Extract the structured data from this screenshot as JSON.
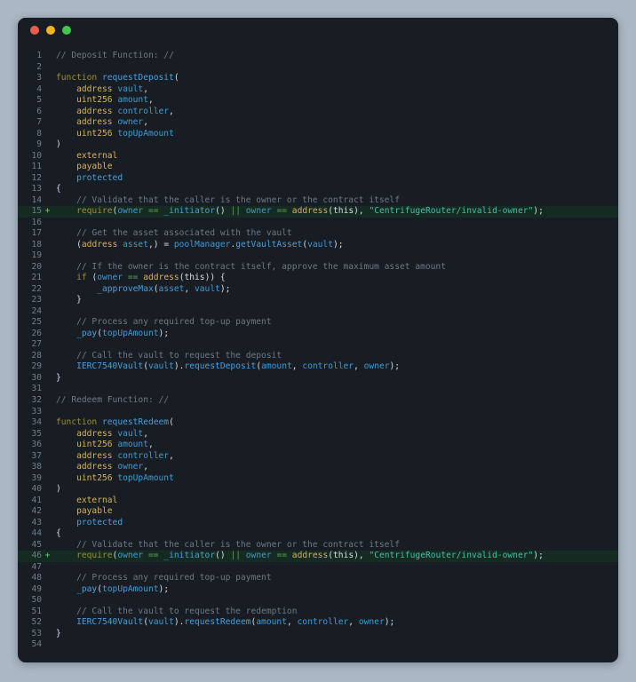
{
  "window": {
    "title": "",
    "traffic_lights": [
      {
        "name": "close-button",
        "color": "#f05c52"
      },
      {
        "name": "minimize-button",
        "color": "#f2b518"
      },
      {
        "name": "maximize-button",
        "color": "#41c64e"
      }
    ]
  },
  "editor": {
    "language": "solidity",
    "theme_background": "#181d24",
    "added_line_background": "#152a21",
    "lines": [
      {
        "n": "1",
        "marker": "",
        "added": false,
        "text": "// Deposit Function: //"
      },
      {
        "n": "2",
        "marker": "",
        "added": false,
        "text": ""
      },
      {
        "n": "3",
        "marker": "",
        "added": false,
        "text": "function requestDeposit("
      },
      {
        "n": "4",
        "marker": "",
        "added": false,
        "text": "    address vault,"
      },
      {
        "n": "5",
        "marker": "",
        "added": false,
        "text": "    uint256 amount,"
      },
      {
        "n": "6",
        "marker": "",
        "added": false,
        "text": "    address controller,"
      },
      {
        "n": "7",
        "marker": "",
        "added": false,
        "text": "    address owner,"
      },
      {
        "n": "8",
        "marker": "",
        "added": false,
        "text": "    uint256 topUpAmount"
      },
      {
        "n": "9",
        "marker": "",
        "added": false,
        "text": ")"
      },
      {
        "n": "10",
        "marker": "",
        "added": false,
        "text": "    external"
      },
      {
        "n": "11",
        "marker": "",
        "added": false,
        "text": "    payable"
      },
      {
        "n": "12",
        "marker": "",
        "added": false,
        "text": "    protected"
      },
      {
        "n": "13",
        "marker": "",
        "added": false,
        "text": "{"
      },
      {
        "n": "14",
        "marker": "",
        "added": false,
        "text": "    // Validate that the caller is the owner or the contract itself"
      },
      {
        "n": "15",
        "marker": "+",
        "added": true,
        "text": "    require(owner == _initiator() || owner == address(this), \"CentrifugeRouter/invalid-owner\");"
      },
      {
        "n": "16",
        "marker": "",
        "added": false,
        "text": ""
      },
      {
        "n": "17",
        "marker": "",
        "added": false,
        "text": "    // Get the asset associated with the vault"
      },
      {
        "n": "18",
        "marker": "",
        "added": false,
        "text": "    (address asset,) = poolManager.getVaultAsset(vault);"
      },
      {
        "n": "19",
        "marker": "",
        "added": false,
        "text": ""
      },
      {
        "n": "20",
        "marker": "",
        "added": false,
        "text": "    // If the owner is the contract itself, approve the maximum asset amount"
      },
      {
        "n": "21",
        "marker": "",
        "added": false,
        "text": "    if (owner == address(this)) {"
      },
      {
        "n": "22",
        "marker": "",
        "added": false,
        "text": "        _approveMax(asset, vault);"
      },
      {
        "n": "23",
        "marker": "",
        "added": false,
        "text": "    }"
      },
      {
        "n": "24",
        "marker": "",
        "added": false,
        "text": ""
      },
      {
        "n": "25",
        "marker": "",
        "added": false,
        "text": "    // Process any required top-up payment"
      },
      {
        "n": "26",
        "marker": "",
        "added": false,
        "text": "    _pay(topUpAmount);"
      },
      {
        "n": "27",
        "marker": "",
        "added": false,
        "text": ""
      },
      {
        "n": "28",
        "marker": "",
        "added": false,
        "text": "    // Call the vault to request the deposit"
      },
      {
        "n": "29",
        "marker": "",
        "added": false,
        "text": "    IERC7540Vault(vault).requestDeposit(amount, controller, owner);"
      },
      {
        "n": "30",
        "marker": "",
        "added": false,
        "text": "}"
      },
      {
        "n": "31",
        "marker": "",
        "added": false,
        "text": ""
      },
      {
        "n": "32",
        "marker": "",
        "added": false,
        "text": "// Redeem Function: //"
      },
      {
        "n": "33",
        "marker": "",
        "added": false,
        "text": ""
      },
      {
        "n": "34",
        "marker": "",
        "added": false,
        "text": "function requestRedeem("
      },
      {
        "n": "35",
        "marker": "",
        "added": false,
        "text": "    address vault,"
      },
      {
        "n": "36",
        "marker": "",
        "added": false,
        "text": "    uint256 amount,"
      },
      {
        "n": "37",
        "marker": "",
        "added": false,
        "text": "    address controller,"
      },
      {
        "n": "38",
        "marker": "",
        "added": false,
        "text": "    address owner,"
      },
      {
        "n": "39",
        "marker": "",
        "added": false,
        "text": "    uint256 topUpAmount"
      },
      {
        "n": "40",
        "marker": "",
        "added": false,
        "text": ")"
      },
      {
        "n": "41",
        "marker": "",
        "added": false,
        "text": "    external"
      },
      {
        "n": "42",
        "marker": "",
        "added": false,
        "text": "    payable"
      },
      {
        "n": "43",
        "marker": "",
        "added": false,
        "text": "    protected"
      },
      {
        "n": "44",
        "marker": "",
        "added": false,
        "text": "{"
      },
      {
        "n": "45",
        "marker": "",
        "added": false,
        "text": "    // Validate that the caller is the owner or the contract itself"
      },
      {
        "n": "46",
        "marker": "+",
        "added": true,
        "text": "    require(owner == _initiator() || owner == address(this), \"CentrifugeRouter/invalid-owner\");"
      },
      {
        "n": "47",
        "marker": "",
        "added": false,
        "text": ""
      },
      {
        "n": "48",
        "marker": "",
        "added": false,
        "text": "    // Process any required top-up payment"
      },
      {
        "n": "49",
        "marker": "",
        "added": false,
        "text": "    _pay(topUpAmount);"
      },
      {
        "n": "50",
        "marker": "",
        "added": false,
        "text": ""
      },
      {
        "n": "51",
        "marker": "",
        "added": false,
        "text": "    // Call the vault to request the redemption"
      },
      {
        "n": "52",
        "marker": "",
        "added": false,
        "text": "    IERC7540Vault(vault).requestRedeem(amount, controller, owner);"
      },
      {
        "n": "53",
        "marker": "",
        "added": false,
        "text": "}"
      },
      {
        "n": "54",
        "marker": "",
        "added": false,
        "text": ""
      }
    ]
  }
}
